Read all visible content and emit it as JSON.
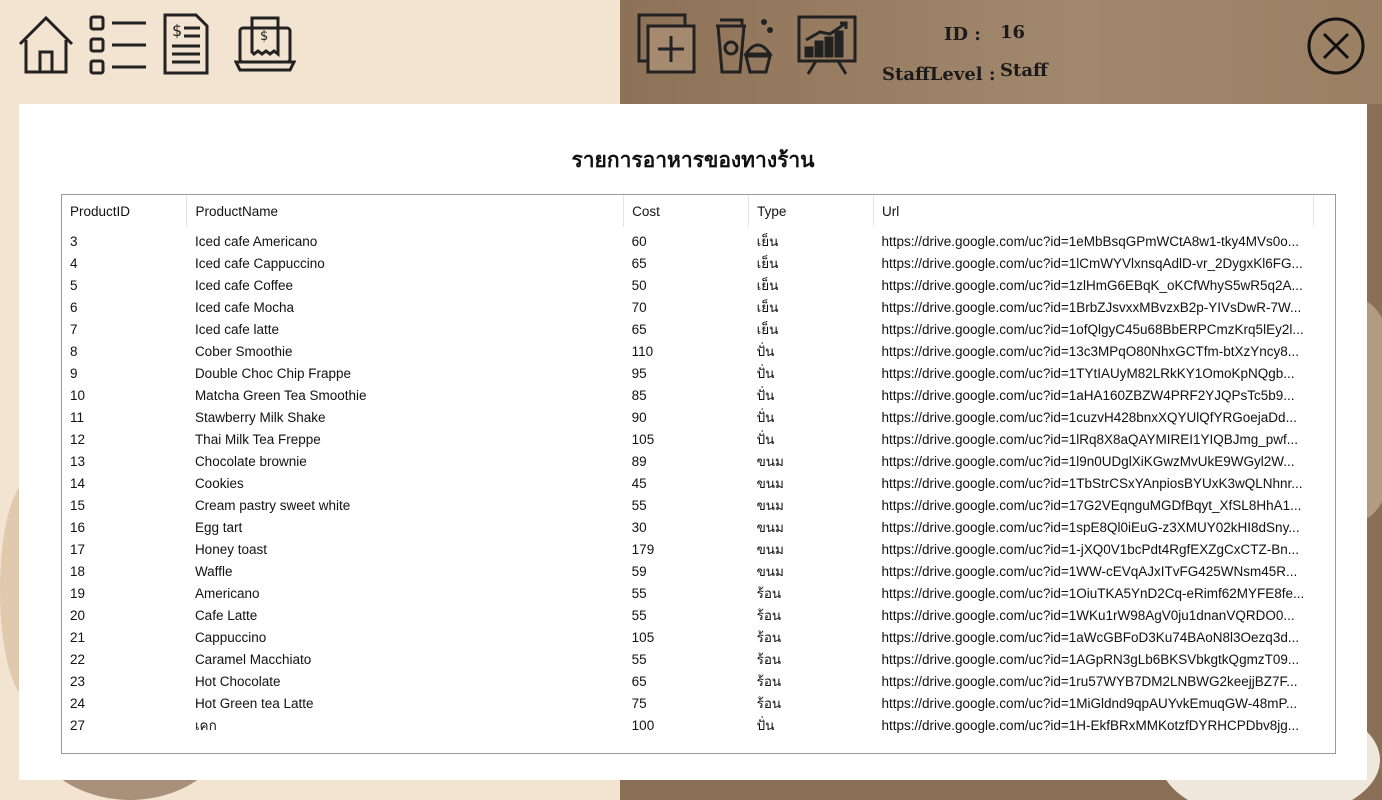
{
  "toolbar": {
    "home_icon": "home-icon",
    "list_icon": "checklist-icon",
    "invoice_icon": "invoice-icon",
    "receipt_icon": "receipt-laptop-icon",
    "add_icon": "add-square-icon",
    "menu_icon": "coffee-cupcake-icon",
    "report_icon": "growth-chart-icon",
    "close_icon": "close-circle-icon"
  },
  "user": {
    "id_label": "ID :",
    "id_value": "16",
    "level_label": "StaffLevel :",
    "level_value": "Staff"
  },
  "panel": {
    "title": "รายการอาหารของทางร้าน"
  },
  "table": {
    "columns": [
      "ProductID",
      "ProductName",
      "Cost",
      "Type",
      "Url"
    ],
    "rows": [
      [
        "3",
        "Iced cafe Americano",
        "60",
        "เย็น",
        "https://drive.google.com/uc?id=1eMbBsqGPmWCtA8w1-tky4MVs0o..."
      ],
      [
        "4",
        "Iced cafe Cappuccino",
        "65",
        "เย็น",
        "https://drive.google.com/uc?id=1lCmWYVlxnsqAdlD-vr_2DygxKl6FG..."
      ],
      [
        "5",
        "Iced cafe Coffee",
        "50",
        "เย็น",
        "https://drive.google.com/uc?id=1zlHmG6EBqK_oKCfWhyS5wR5q2A..."
      ],
      [
        "6",
        "Iced cafe Mocha",
        "70",
        "เย็น",
        "https://drive.google.com/uc?id=1BrbZJsvxxMBvzxB2p-YIVsDwR-7W..."
      ],
      [
        "7",
        "Iced cafe latte",
        "65",
        "เย็น",
        "https://drive.google.com/uc?id=1ofQlgyC45u68BbERPCmzKrq5lEy2l..."
      ],
      [
        "8",
        "Cober Smoothie",
        "110",
        "ปั่น",
        "https://drive.google.com/uc?id=13c3MPqO80NhxGCTfm-btXzYncy8..."
      ],
      [
        "9",
        "Double Choc Chip Frappe",
        "95",
        "ปั่น",
        "https://drive.google.com/uc?id=1TYtIAUyM82LRkKY1OmoKpNQgb..."
      ],
      [
        "10",
        "Matcha Green Tea Smoothie",
        "85",
        "ปั่น",
        "https://drive.google.com/uc?id=1aHA160ZBZW4PRF2YJQPsTc5b9..."
      ],
      [
        "11",
        "Stawberry Milk Shake",
        "90",
        "ปั่น",
        "https://drive.google.com/uc?id=1cuzvH428bnxXQYUlQfYRGoejaDd..."
      ],
      [
        "12",
        "Thai Milk Tea Freppe",
        "105",
        "ปั่น",
        "https://drive.google.com/uc?id=1lRq8X8aQAYMIREI1YIQBJmg_pwf..."
      ],
      [
        "13",
        "Chocolate brownie",
        "89",
        "ขนม",
        "https://drive.google.com/uc?id=1l9n0UDglXiKGwzMvUkE9WGyl2W..."
      ],
      [
        "14",
        "Cookies",
        "45",
        "ขนม",
        "https://drive.google.com/uc?id=1TbStrCSxYAnpiosBYUxK3wQLNhnr..."
      ],
      [
        "15",
        "Cream pastry sweet white",
        "55",
        "ขนม",
        "https://drive.google.com/uc?id=17G2VEqnguMGDfBqyt_XfSL8HhA1..."
      ],
      [
        "16",
        "Egg tart",
        "30",
        "ขนม",
        "https://drive.google.com/uc?id=1spE8Ql0iEuG-z3XMUY02kHI8dSny..."
      ],
      [
        "17",
        "Honey toast",
        "179",
        "ขนม",
        "https://drive.google.com/uc?id=1-jXQ0V1bcPdt4RgfEXZgCxCTZ-Bn..."
      ],
      [
        "18",
        "Waffle",
        "59",
        "ขนม",
        "https://drive.google.com/uc?id=1WW-cEVqAJxITvFG425WNsm45R..."
      ],
      [
        "19",
        "Americano",
        "55",
        "ร้อน",
        "https://drive.google.com/uc?id=1OiuTKA5YnD2Cq-eRimf62MYFE8fe..."
      ],
      [
        "20",
        "Cafe Latte",
        "55",
        "ร้อน",
        "https://drive.google.com/uc?id=1WKu1rW98AgV0ju1dnanVQRDO0..."
      ],
      [
        "21",
        "Cappuccino",
        "105",
        "ร้อน",
        "https://drive.google.com/uc?id=1aWcGBFoD3Ku74BAoN8l3Oezq3d..."
      ],
      [
        "22",
        "Caramel Macchiato",
        "55",
        "ร้อน",
        "https://drive.google.com/uc?id=1AGpRN3gLb6BKSVbkgtkQgmzT09..."
      ],
      [
        "23",
        "Hot Chocolate",
        "65",
        "ร้อน",
        "https://drive.google.com/uc?id=1ru57WYB7DM2LNBWG2keejjBZ7F..."
      ],
      [
        "24",
        "Hot Green tea Latte",
        "75",
        "ร้อน",
        "https://drive.google.com/uc?id=1MiGldnd9qpAUYvkEmuqGW-48mP..."
      ],
      [
        "27",
        "เคก",
        "100",
        "ปั่น",
        "https://drive.google.com/uc?id=1H-EkfBRxMMKotzfDYRHCPDbv8jg..."
      ]
    ]
  }
}
